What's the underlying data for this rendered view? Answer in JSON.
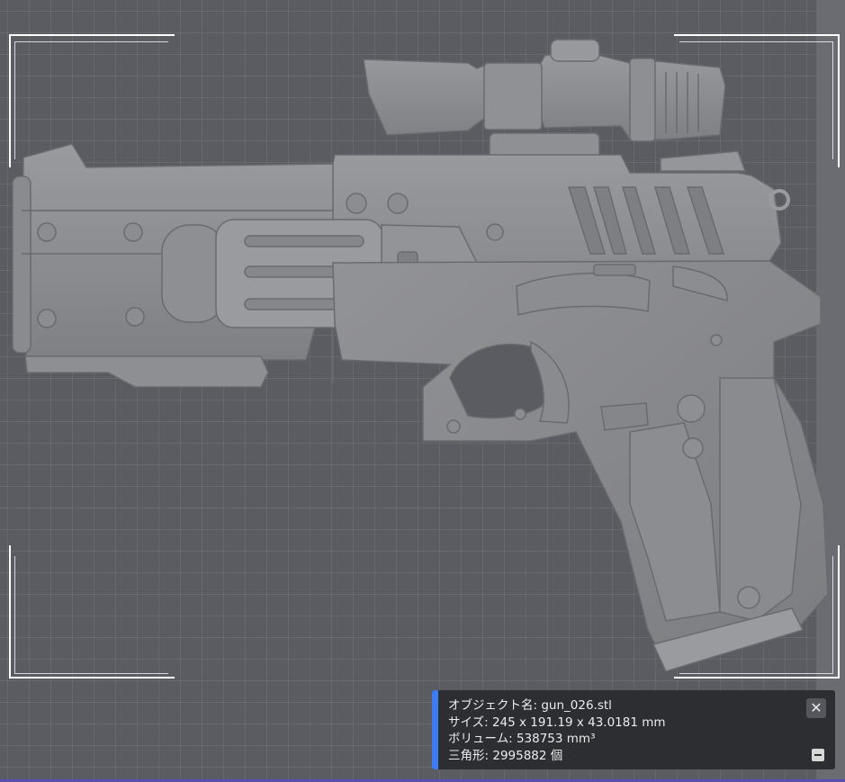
{
  "viewport": {
    "background_color": "#5a5c62",
    "model_color": "#8d8e91"
  },
  "info_panel": {
    "accent_color": "#3d7cf2",
    "object_name_label": "オブジェクト名:",
    "object_name_value": "gun_026.stl",
    "size_label": "サイズ:",
    "size_value": "245 x 191.19 x 43.0181 mm",
    "volume_label": "ボリューム:",
    "volume_value": "538753 mm³",
    "triangles_label": "三角形:",
    "triangles_value": "2995882 個",
    "close_icon": "close-icon",
    "collapse_icon": "minus-icon"
  }
}
